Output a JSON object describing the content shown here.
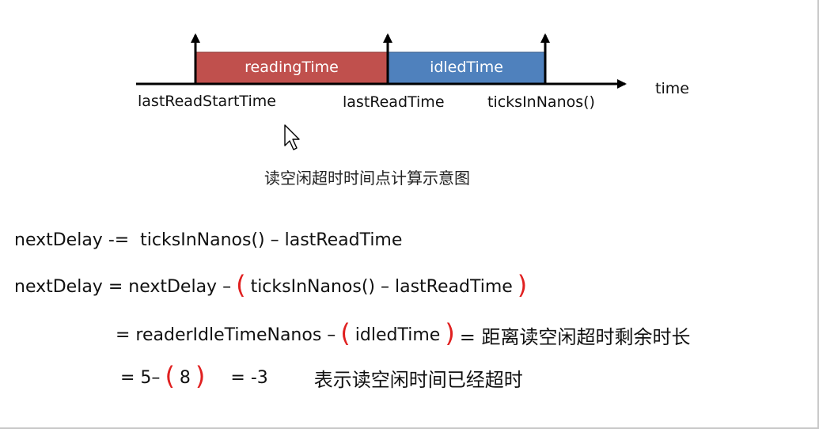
{
  "diagram": {
    "bar_reading_label": "readingTime",
    "bar_idled_label": "idledTime",
    "axis_label": "time",
    "tick_labels": [
      "lastReadStartTime",
      "lastReadTime",
      "ticksInNanos()"
    ],
    "caption": "读空闲超时时间点计算示意图",
    "colors": {
      "reading": "#c0504d",
      "idled": "#4f81bd",
      "paren": "#e02020"
    }
  },
  "formulas": {
    "line1": "nextDelay -=  ticksInNanos() – lastReadTime",
    "line2_pre": "nextDelay = nextDelay –",
    "line2_mid": "ticksInNanos() – lastReadTime",
    "line3_pre": "= readerIdleTimeNanos –",
    "line3_mid": "idledTime",
    "line3_post": "= 距离读空闲超时剩余时长",
    "line4_pre": "= 5–",
    "line4_mid": "8",
    "line4_post": "= -3",
    "line4_note": "表示读空闲时间已经超时",
    "paren_open": "(",
    "paren_close": ")"
  }
}
